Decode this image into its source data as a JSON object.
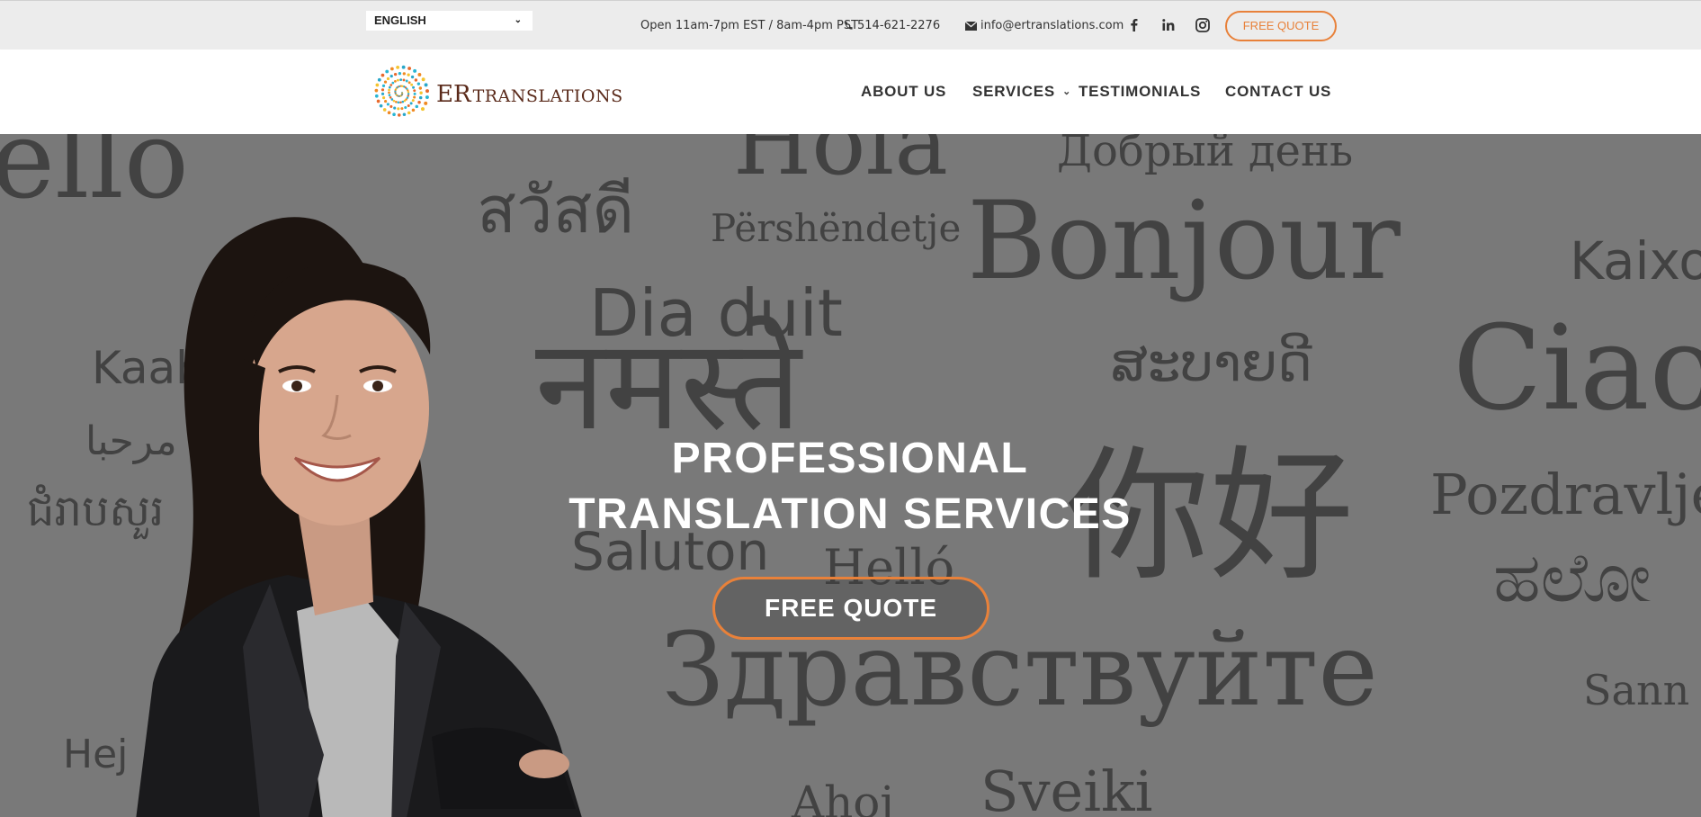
{
  "topbar": {
    "language": "ENGLISH",
    "hours": "Open 11am-7pm EST / 8am-4pm PST",
    "phone": "514-621-2276",
    "email": "info@ertranslations.com",
    "social_icons": [
      "facebook-icon",
      "linkedin-icon",
      "instagram-icon"
    ],
    "quote_button": "FREE QUOTE"
  },
  "logo": {
    "mark": "ER",
    "name": "TRANSLATIONS"
  },
  "nav": {
    "about": "ABOUT US",
    "services": "SERVICES",
    "testimonials": "TESTIMONIALS",
    "contact": "CONTACT US"
  },
  "hero": {
    "title_line1": "PROFESSIONAL",
    "title_line2": "TRANSLATION SERVICES",
    "cta": "FREE QUOTE",
    "background_words": [
      "ello",
      "Hola",
      "Добрый день",
      "สวัสดี",
      "Përshëndetje",
      "Bonjour",
      "Kaixo",
      "Dia duit",
      "Kaabo",
      "Ciao",
      "ສະບາຍດີ",
      "नमस्ते",
      "مرحبا",
      "你好",
      "Pozdravljeno",
      "ជំរាបសួរ",
      "Saluton",
      "Helló",
      "ಹಲೋ",
      "Здравствуйте",
      "Hej",
      "Sveiki",
      "Sann",
      "Ahoj"
    ]
  },
  "colors": {
    "accent": "#e8813a",
    "topbar_bg": "#ececec",
    "nav_text": "#333333",
    "logo_text": "#5a2a1a"
  }
}
